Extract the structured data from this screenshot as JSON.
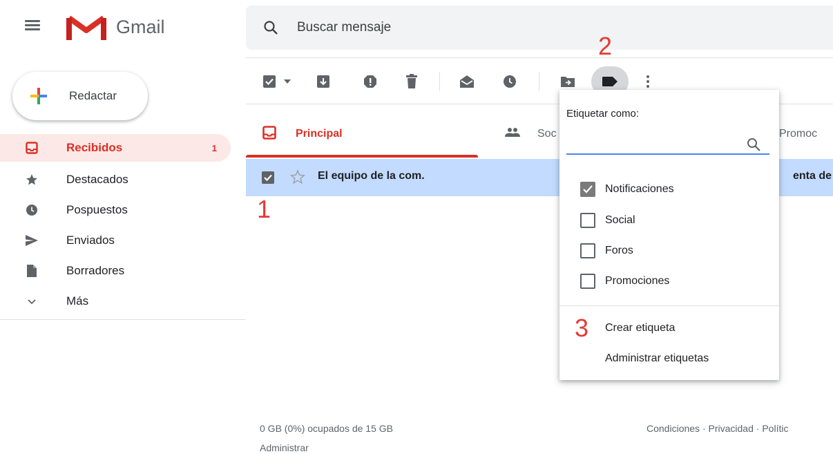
{
  "app": {
    "brand": "Gmail",
    "search_placeholder": "Buscar mensaje"
  },
  "sidebar": {
    "compose_label": "Redactar",
    "items": [
      {
        "label": "Recibidos",
        "icon": "inbox-icon",
        "count": "1",
        "active": true
      },
      {
        "label": "Destacados",
        "icon": "star-icon"
      },
      {
        "label": "Pospuestos",
        "icon": "clock-icon"
      },
      {
        "label": "Enviados",
        "icon": "send-icon"
      },
      {
        "label": "Borradores",
        "icon": "draft-icon"
      },
      {
        "label": "Más",
        "icon": "chevron-down-icon"
      }
    ]
  },
  "toolbar": {
    "icons": [
      "select-all-checkbox-icon",
      "dropdown-arrow-icon",
      "archive-icon",
      "report-spam-icon",
      "delete-icon",
      "mark-read-icon",
      "snooze-icon",
      "move-to-icon",
      "label-icon",
      "more-icon"
    ]
  },
  "tabs": [
    {
      "label": "Principal",
      "active": true
    },
    {
      "label": "Soc"
    },
    {
      "label": "Promoc"
    }
  ],
  "email": {
    "sender": "El equipo de la com.",
    "snippet": "enta de",
    "selected": true
  },
  "label_menu": {
    "title": "Etiquetar como:",
    "options": [
      {
        "label": "Notificaciones",
        "checked": true
      },
      {
        "label": "Social",
        "checked": false
      },
      {
        "label": "Foros",
        "checked": false
      },
      {
        "label": "Promociones",
        "checked": false
      }
    ],
    "create_label": "Crear etiqueta",
    "manage_labels": "Administrar etiquetas"
  },
  "annotations": [
    "1",
    "2",
    "3"
  ],
  "footer": {
    "storage": "0 GB (0%) ocupados de 15 GB",
    "manage": "Administrar",
    "terms": "Condiciones",
    "privacy": "Privacidad",
    "policy": "Polític",
    "separator": " · "
  },
  "colors": {
    "accent_red": "#d93025",
    "selected_row": "#c2dbff",
    "active_nav_bg": "#fce8e6",
    "annotation_red": "#e53935",
    "input_underline": "#4a86e8"
  }
}
